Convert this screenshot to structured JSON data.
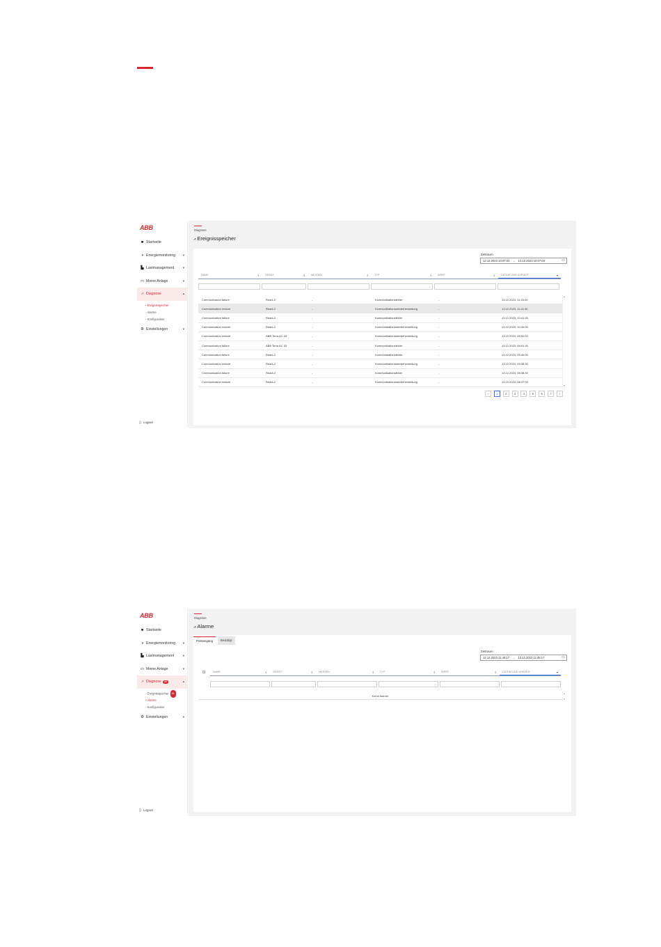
{
  "brand": "ABB",
  "nav": {
    "items": [
      {
        "icon": "home-icon",
        "glyph": "■",
        "label": "Startseite",
        "chev": ""
      },
      {
        "icon": "energy-icon",
        "glyph": "◑",
        "label": "Energiemonitoring",
        "chev": "▾"
      },
      {
        "icon": "load-icon",
        "glyph": "▙",
        "label": "Lastmanagement",
        "chev": "▾"
      },
      {
        "icon": "monitor-icon",
        "glyph": "▭",
        "label": "Meine Anlage",
        "chev": "▾"
      },
      {
        "icon": "diagnosis-icon",
        "glyph": "⩘",
        "label": "Diagnose",
        "chev": "▴"
      }
    ],
    "settings": {
      "glyph": "⚙",
      "label": "Einstellungen",
      "chev": "▾"
    },
    "logout": {
      "glyph": "▯",
      "label": "Logout"
    }
  },
  "screen1": {
    "subnav": [
      "• Ereignisspeicher",
      "◦ Alarme",
      "◦ Konfiguration"
    ],
    "breadcrumb": "Diagnose",
    "title": "Ereignisspeicher",
    "range_label": "Zeitraum",
    "range_from": "12.12.2023 10:07:03",
    "range_to": "13.12.2023 10:07:03",
    "columns": [
      "NAME",
      "GERÄT",
      "MESSEN",
      "TYP",
      "WERT",
      "DATUM UND UHRZEIT"
    ],
    "rows": [
      [
        "Communication failure",
        "React-2",
        "-",
        "Kommunikationsfehler",
        "-",
        "13.12.2023, 11:43:00"
      ],
      [
        "Communication restore",
        "React-2",
        "-",
        "Kommunikationswiederherstellung",
        "-",
        "13.12.2023, 11:41:30"
      ],
      [
        "Communication failure",
        "React-2",
        "-",
        "Kommunikationsfehler",
        "-",
        "13.12.2023, 10:41:30"
      ],
      [
        "Communication restore",
        "React-2",
        "-",
        "Kommunikationswiederherstellung",
        "-",
        "13.12.2023, 10:40:00"
      ],
      [
        "Communication restore",
        "ABB Terra AC 33",
        "-",
        "Kommunikationswiederherstellung",
        "-",
        "13.12.2023, 09:52:00"
      ],
      [
        "Communication failure",
        "ABB Terra AC 33",
        "-",
        "Kommunikationsfehler",
        "-",
        "13.12.2023, 09:51:30"
      ],
      [
        "Communication failure",
        "React-2",
        "-",
        "Kommunikationsfehler",
        "-",
        "13.12.2023, 09:40:00"
      ],
      [
        "Communication restore",
        "React-2",
        "-",
        "Kommunikationswiederherstellung",
        "-",
        "13.12.2023, 09:38:30"
      ],
      [
        "Communication failure",
        "React-2",
        "-",
        "Kommunikationsfehler",
        "-",
        "13.12.2023, 08:38:30"
      ],
      [
        "Communication restore",
        "React-2",
        "-",
        "Kommunikationswiederherstellung",
        "-",
        "13.12.2023, 08:37:00"
      ]
    ],
    "pager": [
      "‹",
      "1",
      "2",
      "3",
      "4",
      "5",
      "6",
      "7",
      "›"
    ]
  },
  "screen2": {
    "diag_badge": "96",
    "subnav": [
      {
        "label": "◦ Ereignisspeicher",
        "badge": "96"
      },
      {
        "label": "• Alarme",
        "badge": ""
      },
      {
        "label": "◦ Konfiguration",
        "badge": ""
      }
    ],
    "breadcrumb": "Diagnose",
    "title": "Alarme",
    "tabs": [
      "Posteingang",
      "Bestätigt"
    ],
    "range_label": "Zeitraum",
    "range_from": "12.12.2023 11:48:17",
    "range_to": "13.12.2023 11:48:17",
    "columns": [
      "NAME",
      "GERÄT",
      "MESSEN",
      "TYP",
      "WERT",
      "DATUM UND UHRZEIT"
    ],
    "empty_text": "Keine Alarme"
  },
  "colors": {
    "accent": "#d9262f",
    "active_blue": "#3a6ee8",
    "panel_bg": "#f2f2f2"
  }
}
